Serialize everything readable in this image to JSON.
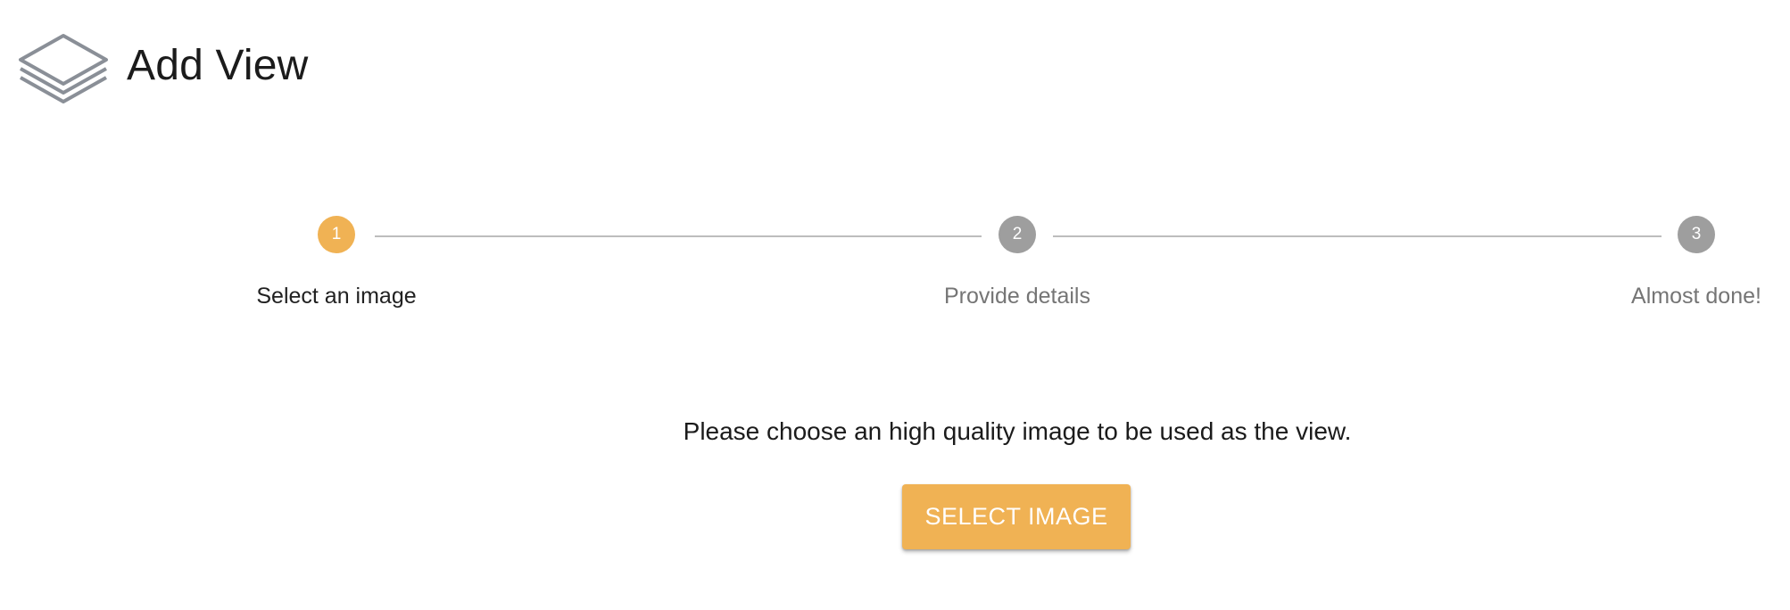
{
  "header": {
    "icon": "layers-icon",
    "title": "Add View"
  },
  "stepper": {
    "steps": [
      {
        "number": "1",
        "label": "Select an image",
        "state": "active"
      },
      {
        "number": "2",
        "label": "Provide details",
        "state": "inactive"
      },
      {
        "number": "3",
        "label": "Almost done!",
        "state": "inactive"
      }
    ]
  },
  "main": {
    "instruction": "Please choose an high quality image to be used as the view.",
    "select_button_label": "SELECT IMAGE"
  },
  "colors": {
    "accent": "#f0b254",
    "inactive_step": "#9e9e9e",
    "connector": "#bdbdbd",
    "icon_stroke": "#8a8f97"
  }
}
